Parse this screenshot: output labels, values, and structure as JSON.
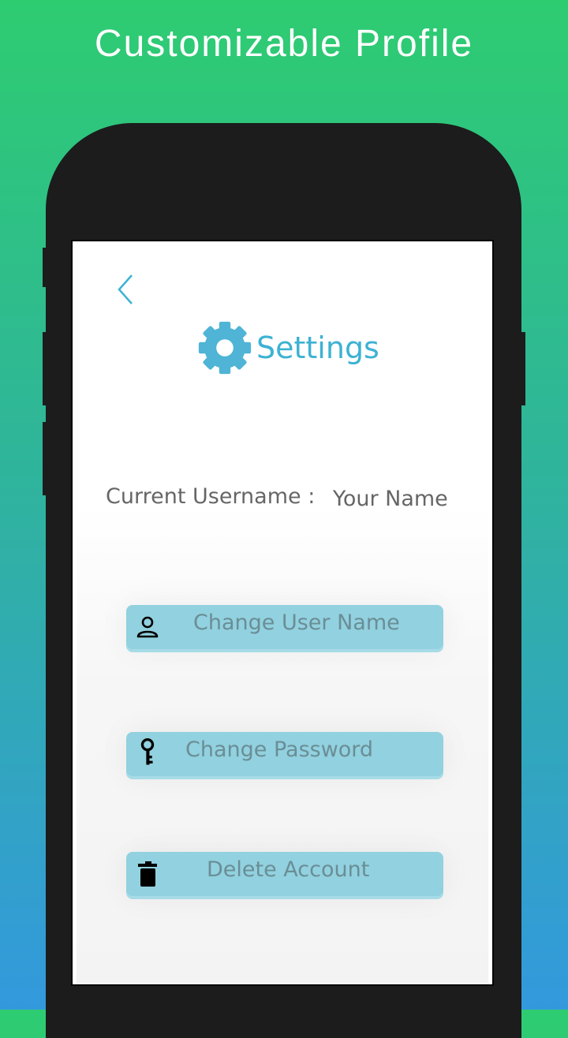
{
  "headline": "Customizable Profile",
  "screen": {
    "title": "Settings",
    "current_username_label": "Current Username :",
    "current_username_value": "Your Name",
    "buttons": {
      "change_username": "Change User Name",
      "change_password": "Change Password",
      "delete_account": "Delete Account"
    },
    "icons": {
      "back": "chevron-left-icon",
      "settings": "gear-icon",
      "user": "person-icon",
      "password": "key-icon",
      "delete": "trash-icon"
    }
  },
  "colors": {
    "accent": "#3db2d3",
    "button_bg": "#92d1df",
    "button_text": "#6a8e96",
    "background_top": "#2ecc71",
    "background_bottom": "#3399dd"
  }
}
